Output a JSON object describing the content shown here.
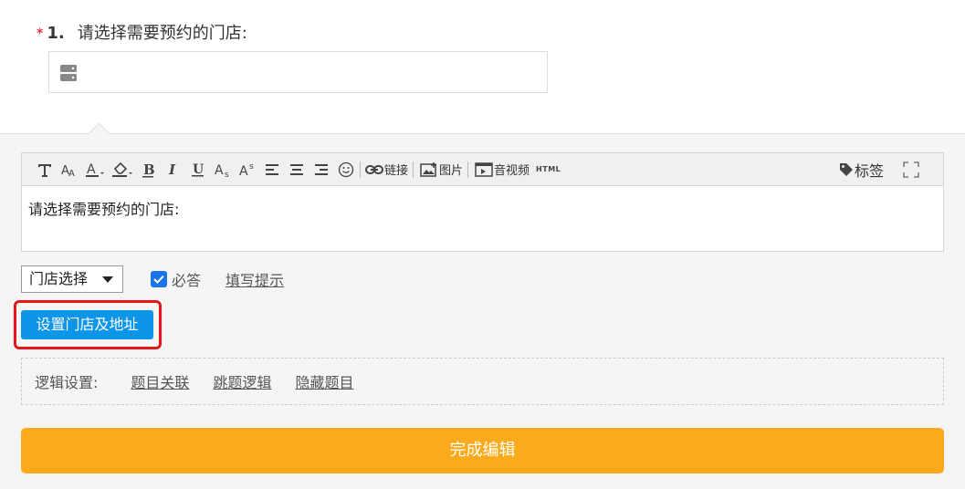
{
  "question": {
    "required_mark": "*",
    "number": "1.",
    "title": "请选择需要预约的门店:"
  },
  "toolbar": {
    "link_label": "链接",
    "image_label": "图片",
    "av_label": "音视频",
    "html_label": "HTML",
    "tag_label": "标签"
  },
  "editor": {
    "content": "请选择需要预约的门店:"
  },
  "controls": {
    "type_select_value": "门店选择",
    "required_label": "必答",
    "hint_label": "填写提示"
  },
  "set_store_button": "设置门店及地址",
  "logic": {
    "label": "逻辑设置:",
    "links": [
      "题目关联",
      "跳题逻辑",
      "隐藏题目"
    ]
  },
  "finish_button": "完成编辑",
  "colors": {
    "required": "#e4393c",
    "primary_blue": "#0d95ea",
    "checkbox_blue": "#1a73e8",
    "highlight_red": "#e8151b",
    "finish_orange": "#fbaa1c"
  }
}
